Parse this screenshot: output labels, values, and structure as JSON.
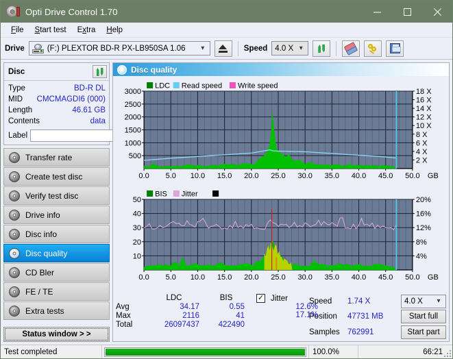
{
  "window": {
    "title": "Opti Drive Control 1.70",
    "icon": "disc-icon",
    "controls": {
      "minimize": "minimize-icon",
      "maximize": "maximize-icon",
      "close": "close-icon"
    }
  },
  "menu": {
    "items": [
      {
        "label": "File",
        "accel": "F"
      },
      {
        "label": "Start test",
        "accel": "S"
      },
      {
        "label": "Extra",
        "accel": "x"
      },
      {
        "label": "Help",
        "accel": "H"
      }
    ]
  },
  "toolbar": {
    "drive_label": "Drive",
    "drive_value": "(F:)  PLEXTOR BD-R  PX-LB950SA 1.06",
    "eject_icon": "eject-icon",
    "speed_label": "Speed",
    "speed_value": "4.0 X",
    "refresh_icon": "refresh-icon",
    "erase_icon": "eraser-icon",
    "keys_icon": "keys-icon",
    "save_icon": "save-icon"
  },
  "disc_panel": {
    "title": "Disc",
    "refresh_icon": "refresh-icon",
    "rows": [
      {
        "key": "Type",
        "value": "BD-R DL"
      },
      {
        "key": "MID",
        "value": "CMCMAGDI6 (000)"
      },
      {
        "key": "Length",
        "value": "46.61 GB"
      },
      {
        "key": "Contents",
        "value": "data"
      }
    ],
    "label_key": "Label",
    "label_value": "",
    "label_placeholder": "",
    "disc_button_icon": "disc-gold-icon"
  },
  "sidebar": {
    "items": [
      {
        "label": "Transfer rate",
        "icon": "disc-icon",
        "active": false
      },
      {
        "label": "Create test disc",
        "icon": "disc-icon",
        "active": false
      },
      {
        "label": "Verify test disc",
        "icon": "disc-icon",
        "active": false
      },
      {
        "label": "Drive info",
        "icon": "disc-icon",
        "active": false
      },
      {
        "label": "Disc info",
        "icon": "disc-icon",
        "active": false
      },
      {
        "label": "Disc quality",
        "icon": "disc-icon",
        "active": true
      },
      {
        "label": "CD Bler",
        "icon": "disc-icon",
        "active": false
      },
      {
        "label": "FE / TE",
        "icon": "disc-icon",
        "active": false
      },
      {
        "label": "Extra tests",
        "icon": "disc-icon",
        "active": false
      }
    ],
    "status_window_button": "Status window > >"
  },
  "main": {
    "header_title": "Disc quality",
    "header_icon": "disc-icon"
  },
  "chart_data": [
    {
      "id": "top",
      "type": "line",
      "title": "",
      "xlabel": "GB",
      "ylabel": "",
      "xlim": [
        0,
        50
      ],
      "xticks": [
        "0.0",
        "5.0",
        "10.0",
        "15.0",
        "20.0",
        "25.0",
        "30.0",
        "35.0",
        "40.0",
        "45.0",
        "50.0"
      ],
      "ylim": [
        0,
        3000
      ],
      "yticks": [
        "500",
        "1000",
        "1500",
        "2000",
        "2500",
        "3000"
      ],
      "y2lim": [
        0,
        18
      ],
      "y2ticks": [
        "2 X",
        "4 X",
        "6 X",
        "8 X",
        "10 X",
        "12 X",
        "14 X",
        "16 X",
        "18 X"
      ],
      "grid": true,
      "legend": [
        {
          "name": "LDC",
          "color": "#008000"
        },
        {
          "name": "Read speed",
          "color": "#66ccf5"
        },
        {
          "name": "Write speed",
          "color": "#f24fc0"
        }
      ],
      "plot_bg": "#6b7a95",
      "end_marker_gb": 47.0,
      "series": [
        {
          "name": "LDC",
          "color": "#00c000",
          "kind": "area",
          "note": "errors per sample, mostly <150 rising to peak 2116 near 24 GB",
          "x": [
            0,
            1,
            2,
            3,
            4,
            5,
            6,
            7,
            8,
            9,
            10,
            11,
            12,
            13,
            14,
            15,
            16,
            17,
            18,
            19,
            20,
            21,
            21.5,
            22,
            22.5,
            23,
            23.5,
            23.8,
            24,
            24.3,
            24.6,
            25,
            25.4,
            25.8,
            26.2,
            26.6,
            27,
            27.5,
            28,
            29,
            30,
            31,
            32,
            33,
            34,
            35,
            36,
            37,
            38,
            39,
            40,
            41,
            42,
            43,
            44,
            45,
            46,
            47
          ],
          "y": [
            60,
            70,
            90,
            85,
            80,
            95,
            90,
            85,
            100,
            95,
            110,
            105,
            100,
            115,
            110,
            120,
            115,
            130,
            125,
            140,
            150,
            200,
            260,
            360,
            520,
            700,
            1050,
            2116,
            900,
            700,
            620,
            760,
            640,
            560,
            520,
            460,
            400,
            340,
            300,
            240,
            200,
            170,
            150,
            140,
            130,
            120,
            115,
            110,
            105,
            100,
            95,
            90,
            88,
            85,
            82,
            80,
            78,
            0
          ]
        },
        {
          "name": "Read speed",
          "color": "#8fd8f8",
          "kind": "line",
          "note": "CAV read speed curve in X units on right axis",
          "x": [
            0,
            5,
            10,
            15,
            20,
            23.5,
            24,
            25,
            30,
            35,
            40,
            45,
            46.5,
            47
          ],
          "y": [
            1.9,
            2.4,
            2.8,
            3.2,
            3.6,
            4.35,
            4.1,
            4.05,
            3.9,
            3.5,
            3.1,
            2.7,
            2.5,
            2.45
          ]
        }
      ]
    },
    {
      "id": "bottom",
      "type": "line",
      "title": "",
      "xlabel": "GB",
      "ylabel": "",
      "xlim": [
        0,
        50
      ],
      "xticks": [
        "0.0",
        "5.0",
        "10.0",
        "15.0",
        "20.0",
        "25.0",
        "30.0",
        "35.0",
        "40.0",
        "45.0",
        "50.0"
      ],
      "ylim": [
        0,
        50
      ],
      "yticks": [
        "10",
        "20",
        "30",
        "40",
        "50"
      ],
      "y2lim": [
        0,
        20
      ],
      "y2ticks": [
        "4%",
        "8%",
        "12%",
        "16%",
        "20%"
      ],
      "grid": true,
      "legend": [
        {
          "name": "BIS",
          "color": "#008000"
        },
        {
          "name": "Jitter",
          "color": "#dba6d8"
        },
        {
          "name": "",
          "color": "#000000"
        }
      ],
      "plot_bg": "#6b7a95",
      "end_marker_gb": 47.0,
      "series": [
        {
          "name": "BIS",
          "color": "#00c000",
          "kind": "area",
          "note": "burst indicator subcode errors, low across disc, elevated 23-27 GB",
          "x": [
            0,
            2,
            4,
            6,
            8,
            10,
            12,
            14,
            16,
            18,
            20,
            21,
            22,
            22.5,
            23,
            23.4,
            23.8,
            24.2,
            24.6,
            25,
            25.4,
            25.8,
            26.2,
            26.6,
            27,
            27.5,
            28,
            29,
            30,
            32,
            34,
            36,
            38,
            40,
            42,
            44,
            46,
            47
          ],
          "y": [
            2,
            3,
            3,
            4,
            3,
            4,
            3,
            4,
            3,
            4,
            4,
            5,
            7,
            9,
            12,
            15,
            17,
            14,
            16,
            11,
            8,
            7,
            6,
            5,
            4,
            4,
            3,
            3,
            3,
            3,
            3,
            3,
            3,
            3,
            3,
            3,
            3,
            0
          ]
        },
        {
          "name": "Jitter",
          "color": "#dda9dd",
          "kind": "line",
          "note": "jitter percent, right axis; average 12.6%, max 17.1%",
          "x": [
            0,
            1,
            2,
            3,
            4,
            5,
            6,
            7,
            8,
            9,
            10,
            11,
            12,
            13,
            14,
            15,
            16,
            17,
            18,
            19,
            20,
            21,
            22,
            23,
            23.5,
            24,
            25,
            26,
            27,
            28,
            29,
            30,
            31,
            32,
            33,
            34,
            35,
            36,
            37,
            38,
            39,
            40,
            40.8,
            41,
            42,
            43,
            44,
            45,
            46,
            46.6
          ],
          "y": [
            12.3,
            12.0,
            12.4,
            13.3,
            12.6,
            12.8,
            13.0,
            12.9,
            13.4,
            13.2,
            12.9,
            13.4,
            12.6,
            12.8,
            12.4,
            12.6,
            12.5,
            12.9,
            12.5,
            12.4,
            12.2,
            11.9,
            12.0,
            12.6,
            13.5,
            13.0,
            12.5,
            12.3,
            12.6,
            12.8,
            13.0,
            12.7,
            12.9,
            13.1,
            13.2,
            12.8,
            12.6,
            12.4,
            12.3,
            12.5,
            12.3,
            12.2,
            15.6,
            12.6,
            12.4,
            12.3,
            12.2,
            12.4,
            12.3,
            12.1
          ]
        }
      ]
    }
  ],
  "results": {
    "columns": [
      "LDC",
      "BIS"
    ],
    "rows": [
      {
        "label": "Avg",
        "ldc": "34.17",
        "bis": "0.55",
        "jitter": "12.6%"
      },
      {
        "label": "Max",
        "ldc": "2116",
        "bis": "41",
        "jitter": "17.1%"
      },
      {
        "label": "Total",
        "ldc": "26097437",
        "bis": "422490",
        "jitter": ""
      }
    ],
    "jitter_label": "Jitter",
    "jitter_checked": true,
    "speed_label": "Speed",
    "speed_value": "1.74 X",
    "speed_select": "4.0 X",
    "position_label": "Position",
    "position_value": "47731 MB",
    "samples_label": "Samples",
    "samples_value": "762991",
    "start_full_button": "Start full",
    "start_part_button": "Start part"
  },
  "statusbar": {
    "message": "Test completed",
    "progress_percent": 100,
    "percent_text": "100.0%",
    "elapsed": "66:21"
  },
  "colors": {
    "titlebar": "#6c7f66",
    "accent": "#0a7fd4",
    "value_text": "#2222cc",
    "plot_bg": "#6b7a95",
    "ldc_green": "#00c000",
    "read_speed": "#8fd8f8",
    "write_speed": "#f24fc0",
    "jitter_pink": "#dda9dd",
    "progress_green": "#0a9f0a"
  }
}
